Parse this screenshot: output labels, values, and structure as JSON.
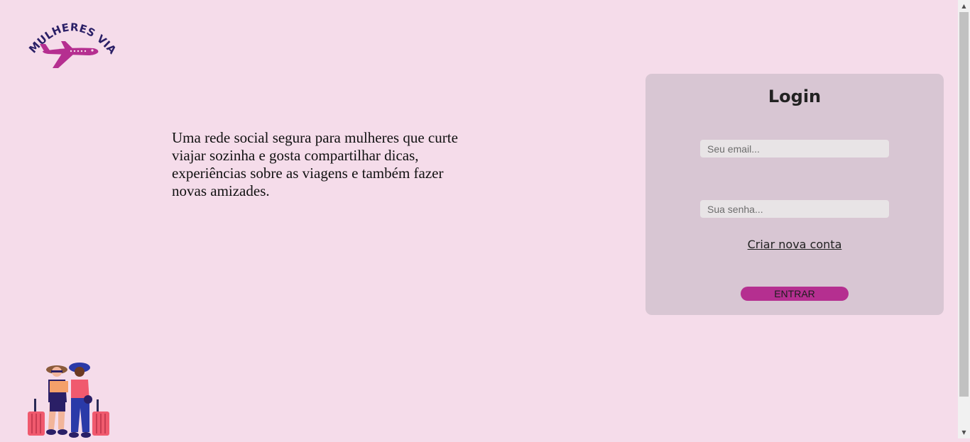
{
  "brand": {
    "logo_text": "MULHERES VIAJANTES"
  },
  "hero": {
    "tagline": "Uma rede social segura para mulheres que curte viajar sozinha e gosta compartilhar dicas, experiências sobre as viagens e também fazer novas amizades."
  },
  "login": {
    "title": "Login",
    "email_placeholder": "Seu email...",
    "password_placeholder": "Sua senha...",
    "create_account_label": "Criar nova conta",
    "submit_label": "ENTRAR"
  },
  "colors": {
    "page_background": "#f5dcea",
    "card_background": "#d8c6d3",
    "accent": "#b52f90",
    "logo_text": "#2a1f66"
  },
  "icons": {
    "logo": "airplane-logo",
    "illustration": "women-travelers-illustration",
    "scroll_up": "scroll-up-arrow",
    "scroll_down": "scroll-down-arrow"
  }
}
